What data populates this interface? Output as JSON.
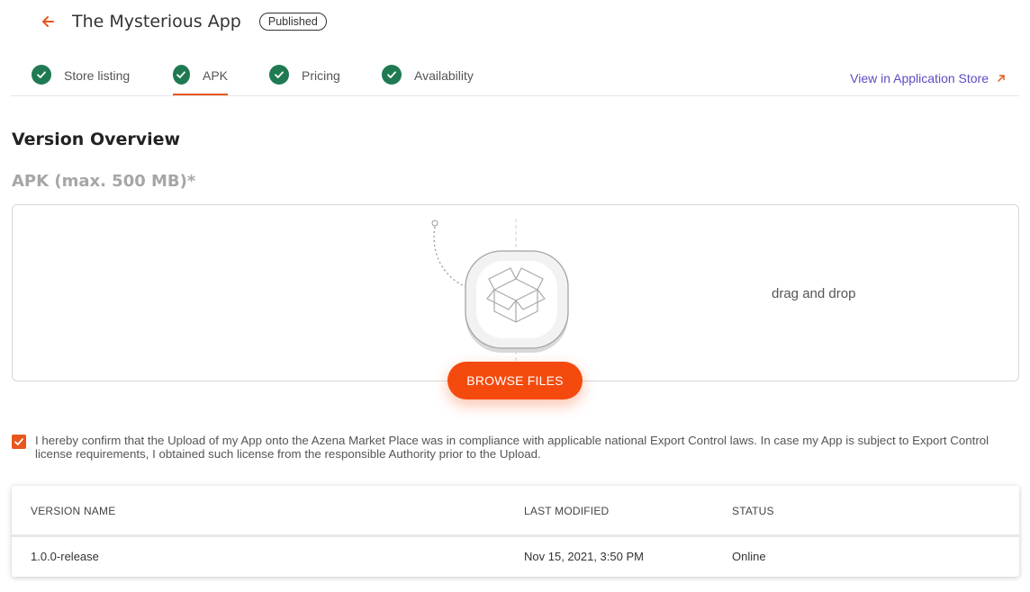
{
  "header": {
    "title": "The Mysterious App",
    "status": "Published"
  },
  "tabs": [
    {
      "label": "Store listing",
      "complete": true
    },
    {
      "label": "APK",
      "complete": true,
      "active": true
    },
    {
      "label": "Pricing",
      "complete": true
    },
    {
      "label": "Availability",
      "complete": true
    }
  ],
  "store_link": {
    "label": "View in Application Store"
  },
  "section": {
    "title": "Version Overview",
    "apk_label": "APK (max. 500 MB)*"
  },
  "upload": {
    "drag_text": "drag and drop",
    "browse_label": "BROWSE FILES"
  },
  "consent": {
    "checked": true,
    "text": "I hereby confirm that the Upload of my App onto the Azena Market Place was in compliance with applicable national Export Control laws. In case my App is subject to Export Control license requirements, I obtained such license from the responsible Authority prior to the Upload."
  },
  "versions_table": {
    "columns": [
      "VERSION NAME",
      "LAST MODIFIED",
      "STATUS"
    ],
    "rows": [
      {
        "name": "1.0.0-release",
        "modified": "Nov 15, 2021, 3:50 PM",
        "status": "Online"
      }
    ]
  },
  "colors": {
    "accent": "#e8571d",
    "button": "#f54a0e",
    "success": "#1f7a52",
    "link": "#5b4ec2"
  },
  "icons": [
    "back-arrow-icon",
    "check-circle-icon",
    "external-link-icon",
    "package-box-icon",
    "checkbox-checked-icon"
  ]
}
